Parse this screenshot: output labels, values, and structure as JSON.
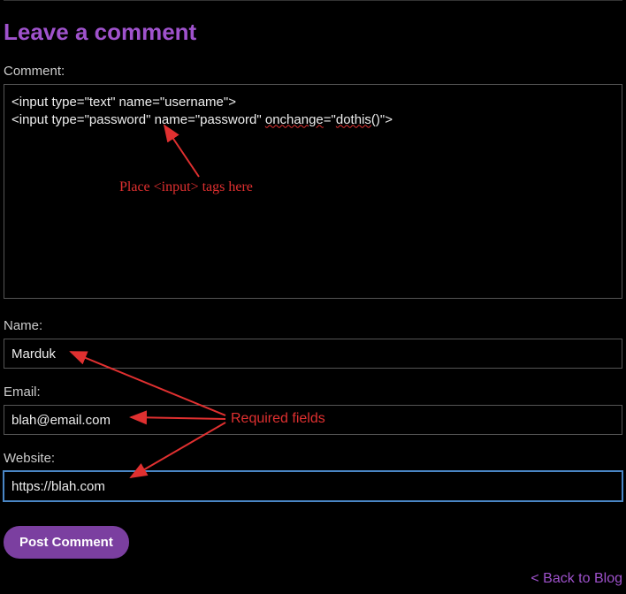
{
  "header": {
    "title": "Leave a comment"
  },
  "form": {
    "comment_label": "Comment:",
    "comment_value_line1": "<input type=\"text\" name=\"username\">",
    "comment_value_line2_a": "<input type=\"password\" name=\"password\" ",
    "comment_value_line2_onchange": "onchange",
    "comment_value_line2_mid": "=\"",
    "comment_value_line2_dothis": "dothis",
    "comment_value_line2_end": "()\">",
    "name_label": "Name:",
    "name_value": "Marduk",
    "email_label": "Email:",
    "email_value": "blah@email.com",
    "website_label": "Website:",
    "website_value": "https://blah.com",
    "submit_label": "Post Comment"
  },
  "footer": {
    "back_link": "< Back to Blog"
  },
  "annotations": {
    "place_inputs": "Place <input> tags here",
    "required_fields": "Required fields"
  },
  "colors": {
    "accent_purple": "#9f52cc",
    "button_purple": "#7b3fa0",
    "annotation_red": "#e03030",
    "focus_blue": "#4a86c5"
  }
}
